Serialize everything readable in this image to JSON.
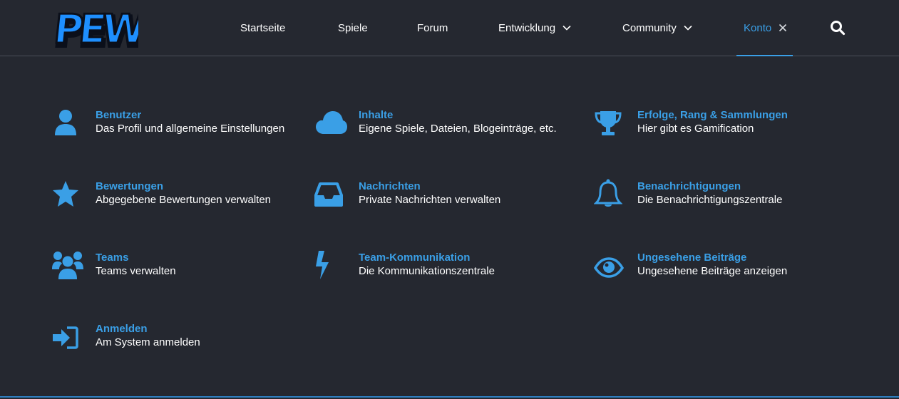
{
  "header": {
    "logo_text": "PEWN!",
    "nav": [
      {
        "label": "Startseite"
      },
      {
        "label": "Spiele"
      },
      {
        "label": "Forum"
      },
      {
        "label": "Entwicklung"
      },
      {
        "label": "Community"
      },
      {
        "label": "Konto"
      }
    ],
    "search_icon": "search-icon"
  },
  "menu": {
    "items": [
      {
        "title": "Benutzer",
        "desc": "Das Profil und allgemeine Einstellungen",
        "icon": "user-icon"
      },
      {
        "title": "Inhalte",
        "desc": "Eigene Spiele, Dateien, Blogeinträge, etc.",
        "icon": "cloud-icon"
      },
      {
        "title": "Erfolge, Rang & Sammlungen",
        "desc": "Hier gibt es Gamification",
        "icon": "trophy-icon"
      },
      {
        "title": "Bewertungen",
        "desc": "Abgegebene Bewertungen verwalten",
        "icon": "star-icon"
      },
      {
        "title": "Nachrichten",
        "desc": "Private Nachrichten verwalten",
        "icon": "inbox-icon"
      },
      {
        "title": "Benachrichtigungen",
        "desc": "Die Benachrichtigungszentrale",
        "icon": "bell-icon"
      },
      {
        "title": "Teams",
        "desc": "Teams verwalten",
        "icon": "users-icon"
      },
      {
        "title": "Team-Kommunikation",
        "desc": "Die Kommunikationszentrale",
        "icon": "bolt-icon"
      },
      {
        "title": "Ungesehene Beiträge",
        "desc": "Ungesehene Beiträge anzeigen",
        "icon": "eye-icon"
      },
      {
        "title": "Anmelden",
        "desc": "Am System anmelden",
        "icon": "sign-in-icon"
      }
    ]
  },
  "colors": {
    "background": "#252830",
    "accent": "#3a9fe6",
    "text": "#ffffff"
  }
}
